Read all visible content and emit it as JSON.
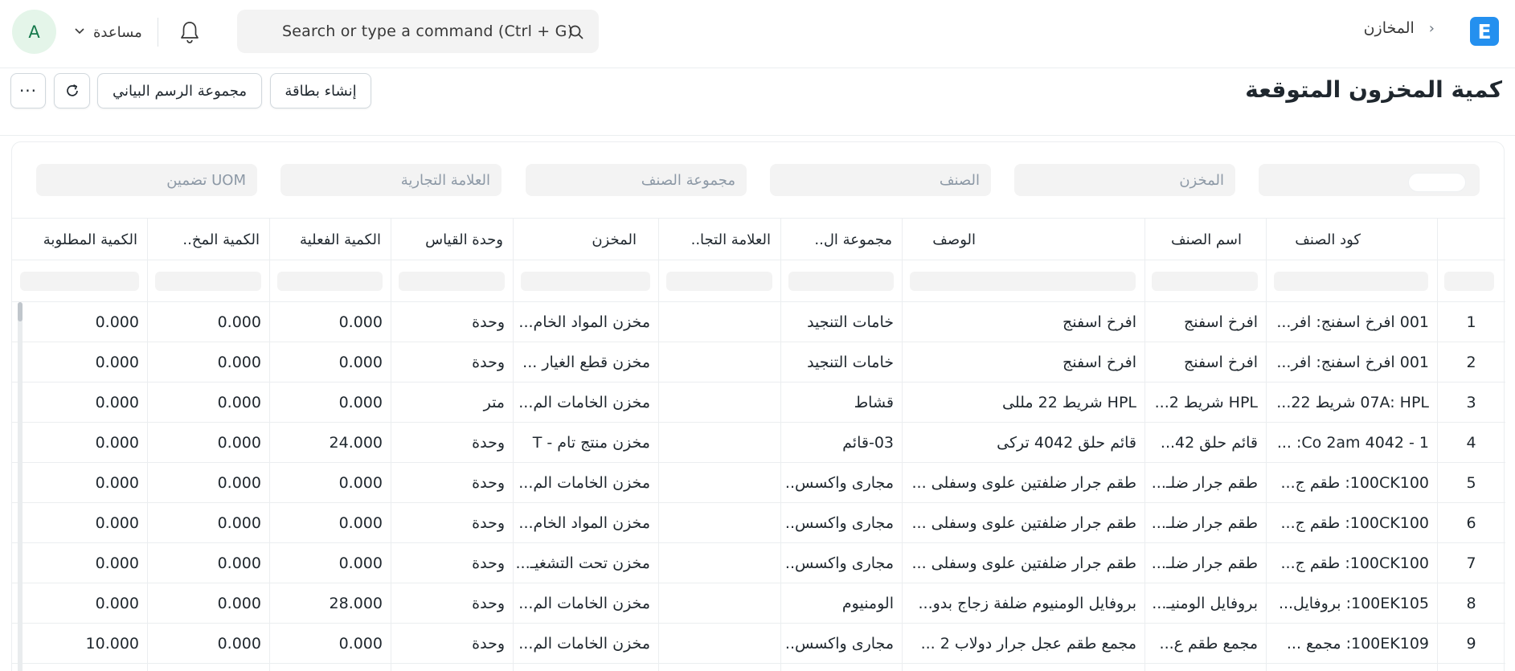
{
  "navbar": {
    "avatar": "A",
    "help_label": "مساعدة",
    "search_placeholder": "Search or type a command (Ctrl + G)",
    "breadcrumb": "المخازن",
    "logo_letter": "E"
  },
  "page": {
    "title": "كمية المخزون المتوقعة",
    "create_card": "إنشاء بطاقة",
    "chart_group": "مجموعة الرسم البياني",
    "more": "···"
  },
  "filters": {
    "warehouse": "المخزن",
    "item": "الصنف",
    "item_group": "مجموعة الصنف",
    "brand": "العلامة التجارية",
    "include_uom": "تضمين UOM"
  },
  "columns": {
    "item_code": "كود الصنف",
    "item_name": "اسم الصنف",
    "description": "الوصف",
    "item_group": "مجموعة ال..",
    "brand": "العلامة التجا..",
    "warehouse": "المخزن",
    "uom": "وحدة القياس",
    "actual_qty": "الكمية الفعلية",
    "projected_qty": "الكمية المخ..",
    "requested_qty": "الكمية المطلوبة"
  },
  "rows": [
    {
      "idx": "1",
      "item_code": "001 افرخ اسفنج: افر...",
      "item_name": "افرخ اسفنج",
      "description": "افرخ اسفنج",
      "item_group": "خامات التنجيد",
      "brand": "",
      "warehouse": "مخزن المواد الخام...",
      "uom": "وحدة",
      "actual_qty": "0.000",
      "projected_qty": "0.000",
      "requested_qty": "0.000"
    },
    {
      "idx": "2",
      "item_code": "001 افرخ اسفنج: افر...",
      "item_name": "افرخ اسفنج",
      "description": "افرخ اسفنج",
      "item_group": "خامات التنجيد",
      "brand": "",
      "warehouse": "مخزن قطع الغيار ...",
      "uom": "وحدة",
      "actual_qty": "0.000",
      "projected_qty": "0.000",
      "requested_qty": "0.000"
    },
    {
      "idx": "3",
      "item_code": "07A: HPL شريط 22...",
      "item_name": "HPL شريط 2...",
      "description": "HPL شريط 22 مللى",
      "item_group": "قشاط",
      "brand": "",
      "warehouse": "مخزن الخامات الم...",
      "uom": "متر",
      "actual_qty": "0.000",
      "projected_qty": "0.000",
      "requested_qty": "0.000"
    },
    {
      "idx": "4",
      "item_code": "1 - Co 2am 4042: ...",
      "item_name": "قائم حلق 42...",
      "description": "قائم حلق 4042 تركى",
      "item_group": "03-قائم",
      "brand": "",
      "warehouse": "مخزن منتج تام - T",
      "uom": "وحدة",
      "actual_qty": "24.000",
      "projected_qty": "0.000",
      "requested_qty": "0.000"
    },
    {
      "idx": "5",
      "item_code": "100CK100: طقم ج...",
      "item_name": "طقم جرار ضلـ...",
      "description": "طقم جرار ضلفتين علوى وسفلى ...",
      "item_group": "مجارى واكسس..",
      "brand": "",
      "warehouse": "مخزن الخامات الم...",
      "uom": "وحدة",
      "actual_qty": "0.000",
      "projected_qty": "0.000",
      "requested_qty": "0.000"
    },
    {
      "idx": "6",
      "item_code": "100CK100: طقم ج...",
      "item_name": "طقم جرار ضلـ...",
      "description": "طقم جرار ضلفتين علوى وسفلى ...",
      "item_group": "مجارى واكسس..",
      "brand": "",
      "warehouse": "مخزن المواد الخام...",
      "uom": "وحدة",
      "actual_qty": "0.000",
      "projected_qty": "0.000",
      "requested_qty": "0.000"
    },
    {
      "idx": "7",
      "item_code": "100CK100: طقم ج...",
      "item_name": "طقم جرار ضلـ...",
      "description": "طقم جرار ضلفتين علوى وسفلى ...",
      "item_group": "مجارى واكسس..",
      "brand": "",
      "warehouse": "مخزن تحت التشغيـ...",
      "uom": "وحدة",
      "actual_qty": "0.000",
      "projected_qty": "0.000",
      "requested_qty": "0.000"
    },
    {
      "idx": "8",
      "item_code": "100EK105: بروفايل...",
      "item_name": "بروفايل الومنيـ...",
      "description": "بروفايل الومنيوم ضلفة زجاج بدو...",
      "item_group": "الومنيوم",
      "brand": "",
      "warehouse": "مخزن الخامات الم...",
      "uom": "وحدة",
      "actual_qty": "28.000",
      "projected_qty": "0.000",
      "requested_qty": "0.000"
    },
    {
      "idx": "9",
      "item_code": "100EK109: مجمع ...",
      "item_name": "مجمع طقم ع...",
      "description": "مجمع طقم عجل جرار دولاب 2 ...",
      "item_group": "مجارى واكسس..",
      "brand": "",
      "warehouse": "مخزن الخامات الم...",
      "uom": "وحدة",
      "actual_qty": "0.000",
      "projected_qty": "0.000",
      "requested_qty": "10.000"
    }
  ]
}
